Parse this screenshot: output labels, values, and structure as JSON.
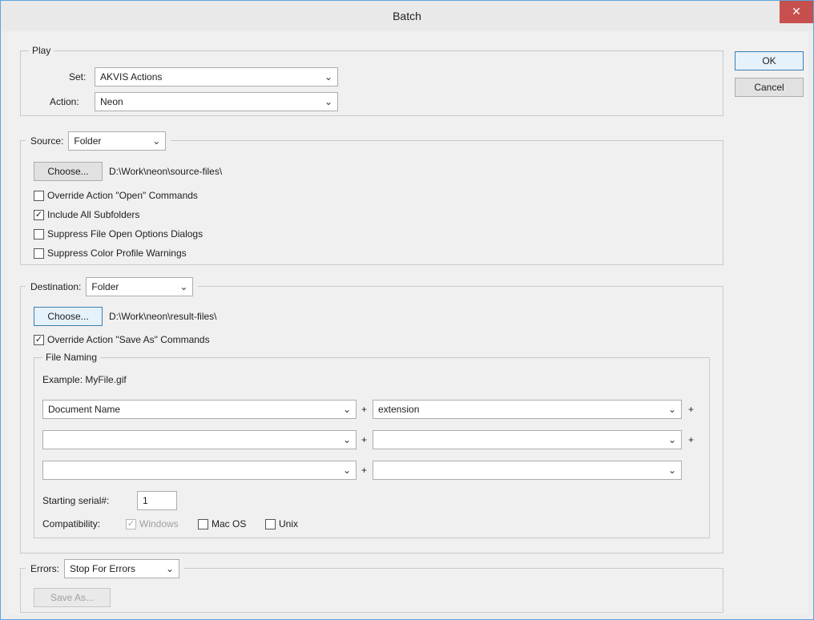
{
  "window": {
    "title": "Batch",
    "close_label": "✕"
  },
  "buttons": {
    "ok": "OK",
    "cancel": "Cancel"
  },
  "play": {
    "legend": "Play",
    "set_label": "Set:",
    "set_value": "AKVIS Actions",
    "action_label": "Action:",
    "action_value": "Neon"
  },
  "source": {
    "label": "Source:",
    "value": "Folder",
    "choose_label": "Choose...",
    "path": "D:\\Work\\neon\\source-files\\",
    "options": [
      {
        "label": "Override Action \"Open\" Commands",
        "checked": false
      },
      {
        "label": "Include All Subfolders",
        "checked": true
      },
      {
        "label": "Suppress File Open Options Dialogs",
        "checked": false
      },
      {
        "label": "Suppress Color Profile Warnings",
        "checked": false
      }
    ]
  },
  "destination": {
    "label": "Destination:",
    "value": "Folder",
    "choose_label": "Choose...",
    "path": "D:\\Work\\neon\\result-files\\",
    "override_label": "Override Action \"Save As\" Commands",
    "override_checked": true
  },
  "file_naming": {
    "legend": "File Naming",
    "example": "Example: MyFile.gif",
    "rows": [
      {
        "left": "Document Name",
        "right": "extension",
        "plus_right": true
      },
      {
        "left": "",
        "right": "",
        "plus_right": true
      },
      {
        "left": "",
        "right": "",
        "plus_right": false
      }
    ],
    "plus_glyph": "+",
    "serial_label": "Starting serial#:",
    "serial_value": "1",
    "compat_label": "Compatibility:",
    "compat": [
      {
        "label": "Windows",
        "checked": true,
        "disabled": true
      },
      {
        "label": "Mac OS",
        "checked": false,
        "disabled": false
      },
      {
        "label": "Unix",
        "checked": false,
        "disabled": false
      }
    ]
  },
  "errors": {
    "label": "Errors:",
    "value": "Stop For Errors",
    "save_as_label": "Save As..."
  },
  "icons": {
    "chevron": "chevron-down-icon",
    "check": "check-icon",
    "close": "close-icon"
  },
  "colors": {
    "close_bg": "#c7504f",
    "window_border": "#5aa5dc",
    "ok_border": "#3c7fb1"
  }
}
